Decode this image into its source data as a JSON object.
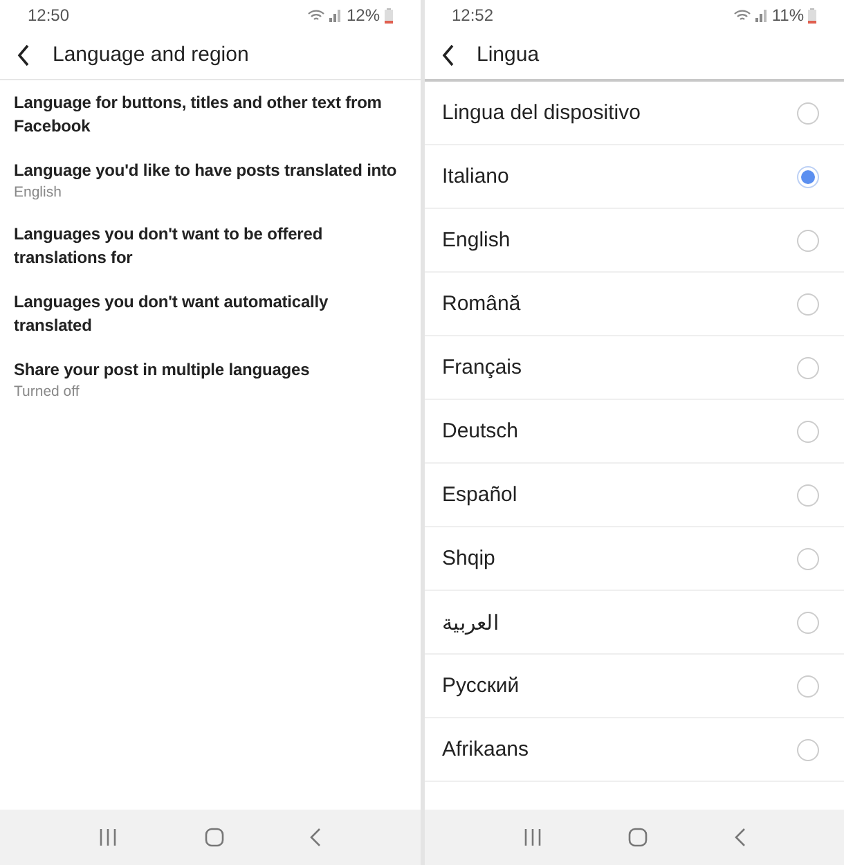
{
  "screens": [
    {
      "status_bar": {
        "time": "12:50",
        "battery": "12%"
      },
      "header": {
        "title": "Language and region"
      },
      "kind": "settings",
      "items": [
        {
          "title": "Language for buttons, titles and other text from Facebook"
        },
        {
          "title": "Language you'd like to have posts translated into",
          "subtitle": "English"
        },
        {
          "title": "Languages you don't want to be offered translations for"
        },
        {
          "title": "Languages you don't want automatically translated"
        },
        {
          "title": "Share your post in multiple languages",
          "subtitle": "Turned off"
        }
      ]
    },
    {
      "status_bar": {
        "time": "12:52",
        "battery": "11%"
      },
      "header": {
        "title": "Lingua"
      },
      "kind": "radio_list",
      "items": [
        {
          "title": "Lingua del dispositivo",
          "selected": false
        },
        {
          "title": "Italiano",
          "selected": true
        },
        {
          "title": "English",
          "selected": false
        },
        {
          "title": "Română",
          "selected": false
        },
        {
          "title": "Français",
          "selected": false
        },
        {
          "title": "Deutsch",
          "selected": false
        },
        {
          "title": "Español",
          "selected": false
        },
        {
          "title": "Shqip",
          "selected": false
        },
        {
          "title": "العربية",
          "selected": false
        },
        {
          "title": "Русский",
          "selected": false
        },
        {
          "title": "Afrikaans",
          "selected": false
        }
      ]
    }
  ]
}
